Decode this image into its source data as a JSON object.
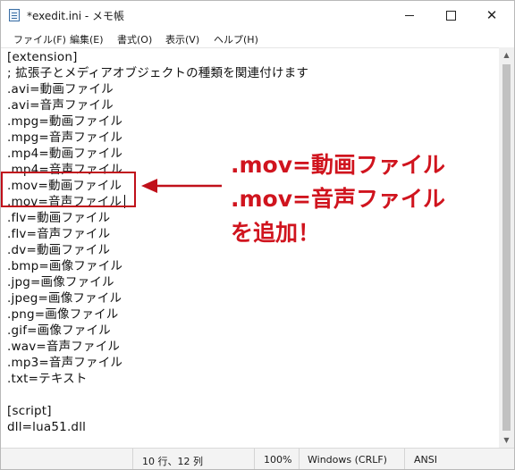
{
  "window": {
    "title": "*exedit.ini - メモ帳",
    "minimize_glyph": "—",
    "maximize_glyph": "□",
    "close_glyph": "✕"
  },
  "menu": [
    "ファイル(F)",
    "編集(E)",
    "書式(O)",
    "表示(V)",
    "ヘルプ(H)"
  ],
  "editor": {
    "lines": [
      "[extension]",
      "; 拡張子とメディアオブジェクトの種類を関連付けます",
      ".avi=動画ファイル",
      ".avi=音声ファイル",
      ".mpg=動画ファイル",
      ".mpg=音声ファイル",
      ".mp4=動画ファイル",
      ".mp4=音声ファイル",
      ".mov=動画ファイル",
      ".mov=音声ファイル",
      ".flv=動画ファイル",
      ".flv=音声ファイル",
      ".dv=動画ファイル",
      ".bmp=画像ファイル",
      ".jpg=画像ファイル",
      ".jpeg=画像ファイル",
      ".png=画像ファイル",
      ".gif=画像ファイル",
      ".wav=音声ファイル",
      ".mp3=音声ファイル",
      ".txt=テキスト",
      "",
      "[script]",
      "dll=lua51.dll"
    ]
  },
  "annotation": {
    "callout_lines": [
      ".mov=動画ファイル",
      ".mov=音声ファイル",
      "を追加！"
    ],
    "accent_color": "#d0141e"
  },
  "status": {
    "position": "10 行、12 列",
    "zoom": "100%",
    "line_ending": "Windows (CRLF)",
    "encoding": "ANSI"
  }
}
